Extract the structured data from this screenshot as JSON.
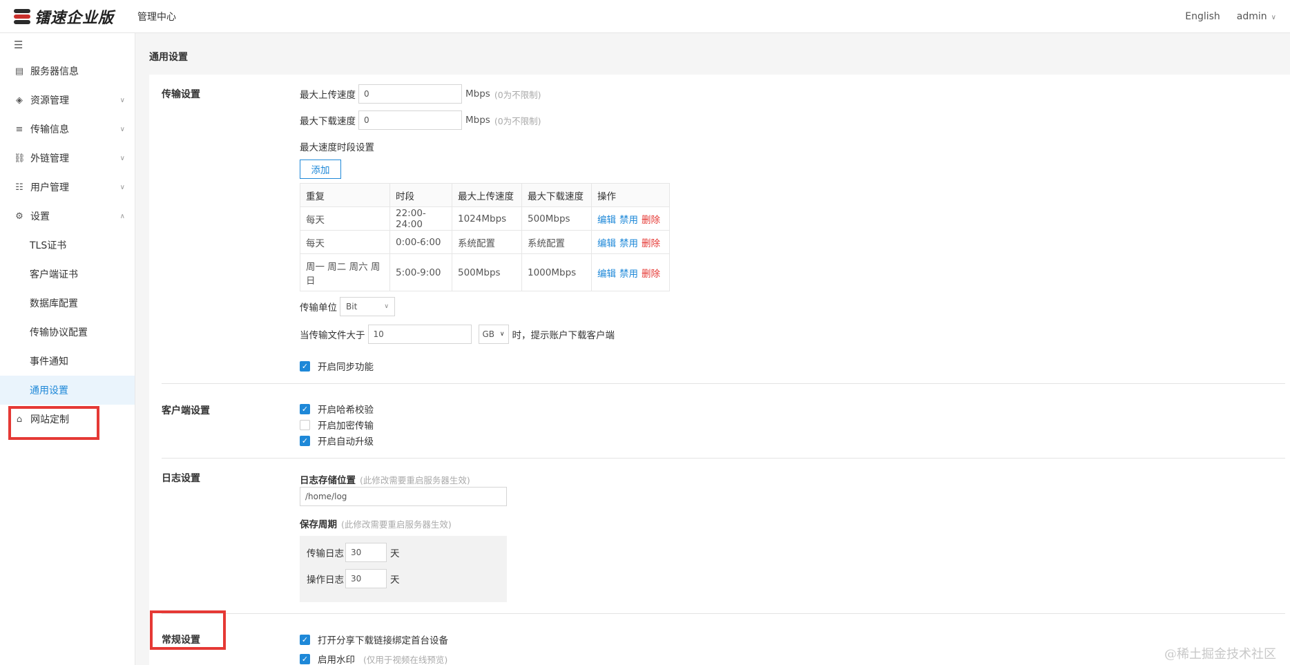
{
  "header": {
    "logo_text": "镭速企业版",
    "center_title": "管理中心",
    "language": "English",
    "user": "admin"
  },
  "sidebar": {
    "toggle_icon": "menu-collapse-icon",
    "items": [
      {
        "label": "服务器信息",
        "icon": "server-icon"
      },
      {
        "label": "资源管理",
        "icon": "layers-icon"
      },
      {
        "label": "传输信息",
        "icon": "list-icon"
      },
      {
        "label": "外链管理",
        "icon": "link-icon"
      },
      {
        "label": "用户管理",
        "icon": "users-icon"
      },
      {
        "label": "设置",
        "icon": "gear-icon"
      }
    ],
    "sub_items": [
      "TLS证书",
      "客户端证书",
      "数据库配置",
      "传输协议配置",
      "事件通知",
      "通用设置"
    ],
    "last_item": {
      "label": "网站定制",
      "icon": "shirt-icon"
    }
  },
  "page": {
    "title": "通用设置",
    "transfer": {
      "label": "传输设置",
      "max_upload_label": "最大上传速度",
      "max_upload_value": "0",
      "max_download_label": "最大下载速度",
      "max_download_value": "0",
      "unit": "Mbps",
      "unlimited_hint": "(0为不限制)",
      "period_label": "最大速度时段设置",
      "add_button": "添加",
      "table": {
        "headers": [
          "重复",
          "时段",
          "最大上传速度",
          "最大下载速度",
          "操作"
        ],
        "rows": [
          {
            "repeat": "每天",
            "period": "22:00-24:00",
            "up": "1024Mbps",
            "down": "500Mbps"
          },
          {
            "repeat": "每天",
            "period": "0:00-6:00",
            "up": "系统配置",
            "down": "系统配置"
          },
          {
            "repeat": "周一 周二 周六 周日",
            "period": "5:00-9:00",
            "up": "500Mbps",
            "down": "1000Mbps"
          }
        ],
        "actions": {
          "edit": "编辑",
          "disable": "禁用",
          "delete": "删除"
        }
      },
      "unit_label": "传输单位",
      "unit_value": "Bit",
      "file_size_label": "当传输文件大于",
      "file_size_value": "10",
      "file_size_unit": "GB",
      "file_size_suffix": "时，提示账户下载客户端",
      "sync_label": "开启同步功能"
    },
    "client": {
      "label": "客户端设置",
      "options": [
        {
          "label": "开启哈希校验",
          "checked": true
        },
        {
          "label": "开启加密传输",
          "checked": false
        },
        {
          "label": "开启自动升级",
          "checked": true
        }
      ]
    },
    "log": {
      "label": "日志设置",
      "storage_label": "日志存储位置",
      "restart_hint": "(此修改需要重启服务器生效)",
      "storage_value": "/home/log",
      "retention_label": "保存周期",
      "transfer_log_label": "传输日志",
      "transfer_log_value": "30",
      "operation_log_label": "操作日志",
      "operation_log_value": "30",
      "day_unit": "天"
    },
    "general": {
      "label": "常规设置",
      "share_bind_label": "打开分享下载链接绑定首台设备",
      "watermark_label": "启用水印",
      "watermark_hint": "(仅用于视频在线预览)"
    }
  },
  "watermark": "@稀土掘金技术社区",
  "colors": {
    "accent": "#1e88d8",
    "danger": "#e53935",
    "highlight": "#e53935"
  }
}
